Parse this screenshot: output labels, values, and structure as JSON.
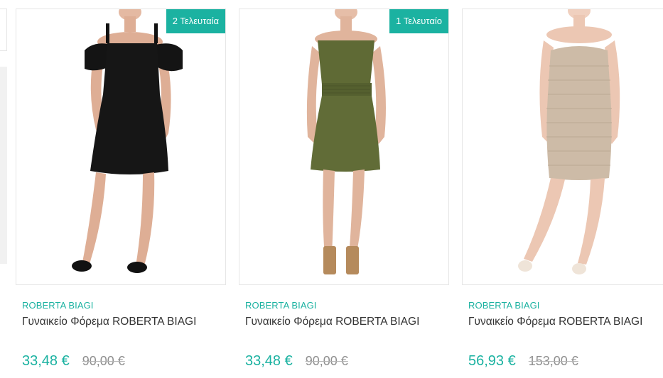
{
  "products": [
    {
      "badge": "2 Τελευταία",
      "brand": "ROBERTA BIAGI",
      "title": "Γυναικείο Φόρεμα ROBERTA BIAGI",
      "price": "33,48 €",
      "old_price": "90,00 €",
      "image": "black-off-shoulder-dress-photo"
    },
    {
      "badge": "1 Τελευταίο",
      "brand": "ROBERTA BIAGI",
      "title": "Γυναικείο Φόρεμα ROBERTA BIAGI",
      "price": "33,48 €",
      "old_price": "90,00 €",
      "image": "olive-strapless-dress-photo"
    },
    {
      "brand": "ROBERTA BIAGI",
      "title": "Γυναικείο Φόρεμα ROBERTA BIAGI",
      "price": "56,93 €",
      "old_price": "153,00 €",
      "image": "beige-strapless-dress-photo"
    }
  ],
  "colors": {
    "accent": "#1bb2a1",
    "title_text": "#333333",
    "old_price_text": "#8f8f8f",
    "border": "#e6e6e6"
  }
}
